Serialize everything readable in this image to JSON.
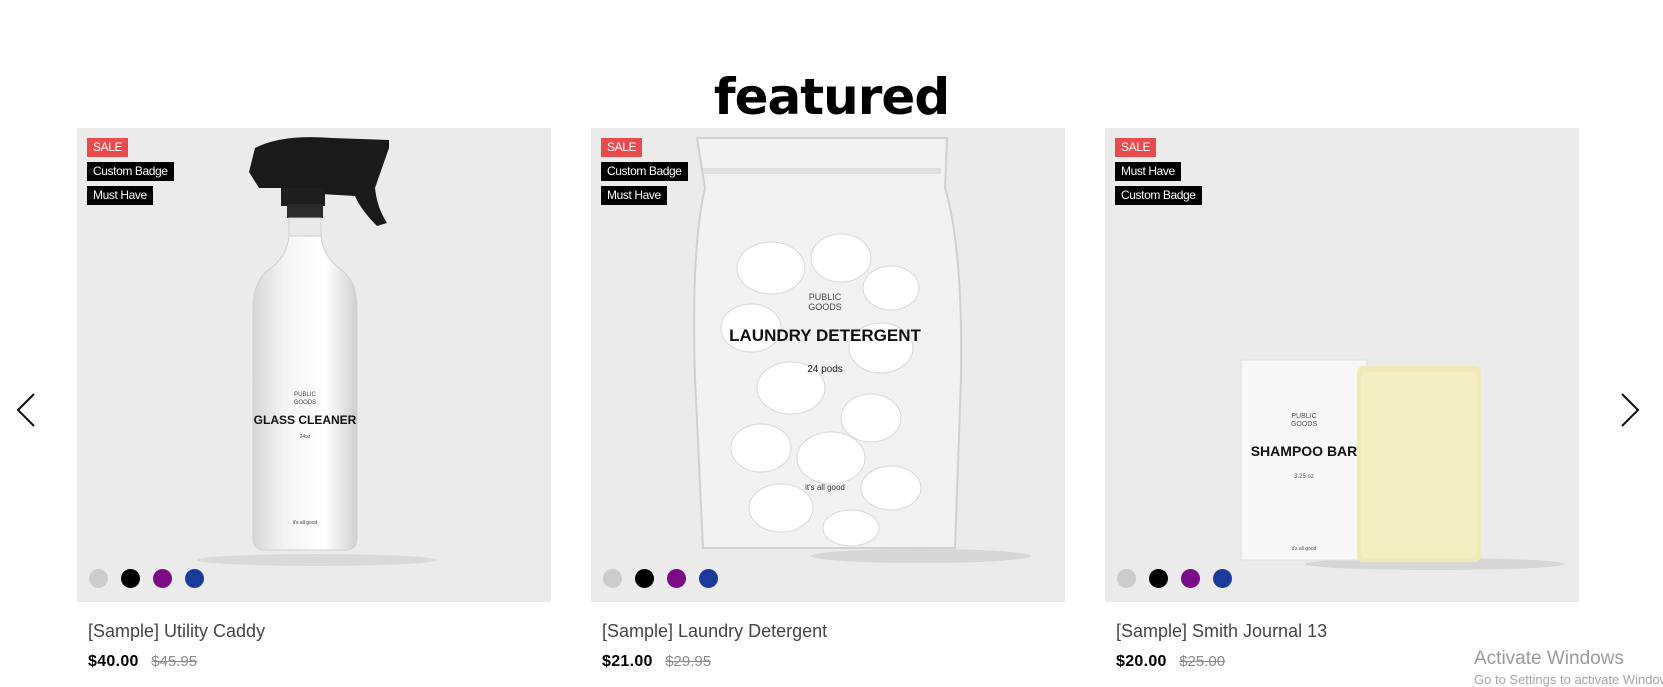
{
  "section": {
    "title": "featured"
  },
  "nav": {
    "prev_icon": "chevron-left-icon",
    "next_icon": "chevron-right-icon"
  },
  "swatch_colors": [
    "#cccccc",
    "#000000",
    "#7a0a86",
    "#1a3b9a"
  ],
  "products": [
    {
      "badges": [
        "SALE",
        "Custom Badge",
        "Must Have"
      ],
      "image_label": {
        "brand": "PUBLIC\nGOODS",
        "name": "GLASS CLEANER",
        "size": "24oz",
        "tagline": "it's all good"
      },
      "title": "[Sample] Utility Caddy",
      "price": "$40.00",
      "original_price": "$45.95"
    },
    {
      "badges": [
        "SALE",
        "Custom Badge",
        "Must Have"
      ],
      "image_label": {
        "brand": "PUBLIC\nGOODS",
        "name": "LAUNDRY DETERGENT",
        "size": "24 pods",
        "tagline": "it's all good"
      },
      "title": "[Sample] Laundry Detergent",
      "price": "$21.00",
      "original_price": "$29.95"
    },
    {
      "badges": [
        "SALE",
        "Must Have",
        "Custom Badge"
      ],
      "image_label": {
        "brand": "PUBLIC\nGOODS",
        "name": "SHAMPOO BAR",
        "size": "3.25 oz",
        "tagline": "it's all good"
      },
      "title": "[Sample] Smith Journal 13",
      "price": "$20.00",
      "original_price": "$25.00"
    }
  ],
  "watermark": {
    "title": "Activate Windows",
    "subtitle": "Go to Settings to activate Windows."
  }
}
